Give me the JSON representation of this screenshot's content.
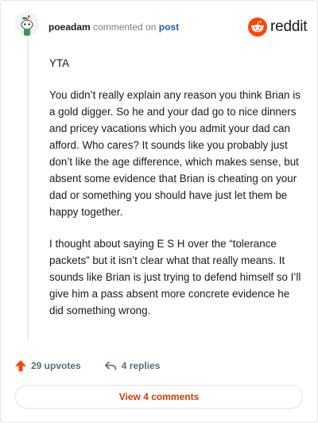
{
  "header": {
    "username": "poeadam",
    "action": "commented on",
    "target": "post",
    "brand": "reddit"
  },
  "comment": {
    "paragraphs": [
      "YTA",
      "You didn’t really explain any reason you think Brian is a gold digger. So he and your dad go to nice dinners and pricey vacations which you admit your dad can afford. Who cares? It sounds like you probably just don’t like the age difference, which makes sense, but absent some evidence that Brian is cheating on your dad or something you should have just let them be happy together.",
      "I thought about saying E S H over the “tolerance packets” but it isn’t clear what that really means. It sounds like Brian is just trying to defend himself so I’ll give him a pass absent more concrete evidence he did something wrong."
    ]
  },
  "footer": {
    "upvotes": "29 upvotes",
    "replies": "4 replies",
    "view_comments": "View 4 comments"
  },
  "colors": {
    "accent": "#ff4500",
    "link": "#1d5fa8",
    "meta": "#576f76",
    "button_text": "#d93900"
  },
  "icons": {
    "avatar": "snoo-avatar-icon",
    "brand": "reddit-logo-icon",
    "upvote": "upvote-arrow-icon",
    "reply": "reply-arrow-icon"
  }
}
